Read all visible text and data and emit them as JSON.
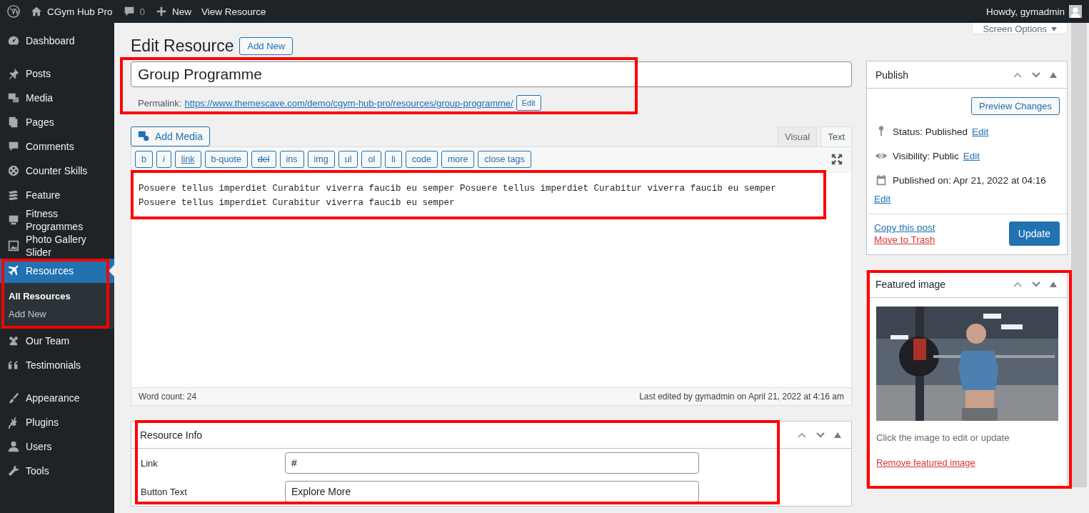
{
  "admin_bar": {
    "site_name": "CGym Hub Pro",
    "comments_count": "0",
    "new_label": "New",
    "view_label": "View Resource",
    "greeting": "Howdy, gymadmin"
  },
  "sidebar": {
    "highlighted": true,
    "items": [
      {
        "label": "Dashboard",
        "selected": false
      },
      {
        "label": "Posts",
        "selected": false
      },
      {
        "label": "Media",
        "selected": false
      },
      {
        "label": "Pages",
        "selected": false
      },
      {
        "label": "Comments",
        "selected": false
      },
      {
        "label": "Counter Skills",
        "selected": false
      },
      {
        "label": "Feature",
        "selected": false
      },
      {
        "label": "Fitness Programmes",
        "selected": false
      },
      {
        "label": "Photo Gallery Slider",
        "selected": false
      },
      {
        "label": "Resources",
        "selected": true,
        "children": [
          {
            "label": "All Resources",
            "selected": true
          },
          {
            "label": "Add New",
            "selected": false
          }
        ]
      },
      {
        "label": "Our Team",
        "selected": false
      },
      {
        "label": "Testimonials",
        "selected": false
      },
      {
        "label": "Appearance",
        "selected": false
      },
      {
        "label": "Plugins",
        "selected": false
      },
      {
        "label": "Users",
        "selected": false
      },
      {
        "label": "Tools",
        "selected": false
      }
    ]
  },
  "screen_options": "Screen Options",
  "page": {
    "heading": "Edit Resource",
    "add_new": "Add New"
  },
  "title_section": {
    "highlighted": true,
    "title": "Group Programme",
    "permalink_label": "Permalink:",
    "permalink_url": "https://www.themescave.com/demo/cgym-hub-pro/resources/group-programme/",
    "edit_button": "Edit"
  },
  "editor": {
    "add_media": "Add Media",
    "tabs": [
      {
        "label": "Visual",
        "selected": false
      },
      {
        "label": "Text",
        "selected": true
      }
    ],
    "quicktags": [
      {
        "label": "b",
        "kind": "plain"
      },
      {
        "label": "i",
        "kind": "italic"
      },
      {
        "label": "link",
        "kind": "link"
      },
      {
        "label": "b-quote",
        "kind": "plain"
      },
      {
        "label": "del",
        "kind": "strike"
      },
      {
        "label": "ins",
        "kind": "plain"
      },
      {
        "label": "img",
        "kind": "plain"
      },
      {
        "label": "ul",
        "kind": "plain"
      },
      {
        "label": "ol",
        "kind": "plain"
      },
      {
        "label": "li",
        "kind": "plain"
      },
      {
        "label": "code",
        "kind": "plain"
      },
      {
        "label": "more",
        "kind": "plain"
      },
      {
        "label": "close tags",
        "kind": "plain"
      }
    ],
    "content_lines": [
      "Posuere tellus imperdiet Curabitur viverra faucib eu semper Posuere tellus imperdiet Curabitur viverra faucib eu semper",
      "Posuere tellus imperdiet Curabitur viverra faucib eu semper"
    ],
    "highlighted": true,
    "word_count": "Word count: 24",
    "last_edited": "Last edited by gymadmin on April 21, 2022 at 4:16 am"
  },
  "resource_info": {
    "title": "Resource Info",
    "highlighted": true,
    "fields": [
      {
        "label": "Link",
        "value": "#"
      },
      {
        "label": "Button Text",
        "value": "Explore More"
      }
    ]
  },
  "publish": {
    "title": "Publish",
    "preview_button": "Preview Changes",
    "rows": [
      {
        "kind": "status",
        "text": "Status: Published",
        "link": "Edit"
      },
      {
        "kind": "visibility",
        "text": "Visibility: Public",
        "link": "Edit"
      },
      {
        "kind": "date",
        "text": "Published on: Apr 21, 2022 at 04:16",
        "link": "Edit"
      }
    ],
    "copy_link": "Copy this post",
    "trash_link": "Move to Trash",
    "update_button": "Update"
  },
  "featured_image": {
    "title": "Featured image",
    "highlighted": true,
    "hint": "Click the image to edit or update",
    "remove_link": "Remove featured image"
  }
}
